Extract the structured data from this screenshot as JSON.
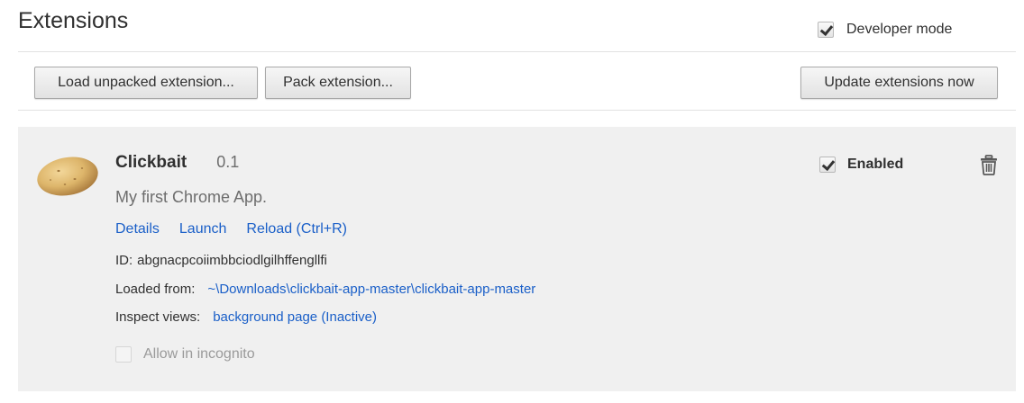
{
  "header": {
    "title": "Extensions",
    "developer_mode_label": "Developer mode",
    "developer_mode_checked": true
  },
  "toolbar": {
    "load_unpacked_label": "Load unpacked extension...",
    "pack_label": "Pack extension...",
    "update_label": "Update extensions now"
  },
  "extension": {
    "icon": "potato-icon",
    "name": "Clickbait",
    "version": "0.1",
    "description": "My first Chrome App.",
    "links": {
      "details": "Details",
      "launch": "Launch",
      "reload": "Reload (Ctrl+R)"
    },
    "id_label": "ID:",
    "id_value": "abgnacpcoiimbbciodlgilhffengllfi",
    "loaded_from_label": "Loaded from:",
    "loaded_from_value": "~\\Downloads\\clickbait-app-master\\clickbait-app-master",
    "inspect_views_label": "Inspect views:",
    "inspect_views_value": "background page (Inactive)",
    "incognito_label": "Allow in incognito",
    "incognito_checked": false,
    "incognito_disabled": true,
    "enabled_label": "Enabled",
    "enabled_checked": true,
    "delete_icon": "trash-icon"
  },
  "colors": {
    "link": "#1a5fc8",
    "card_background": "#f0f0f0",
    "text": "#303030",
    "muted_text": "#6d6d6d"
  }
}
